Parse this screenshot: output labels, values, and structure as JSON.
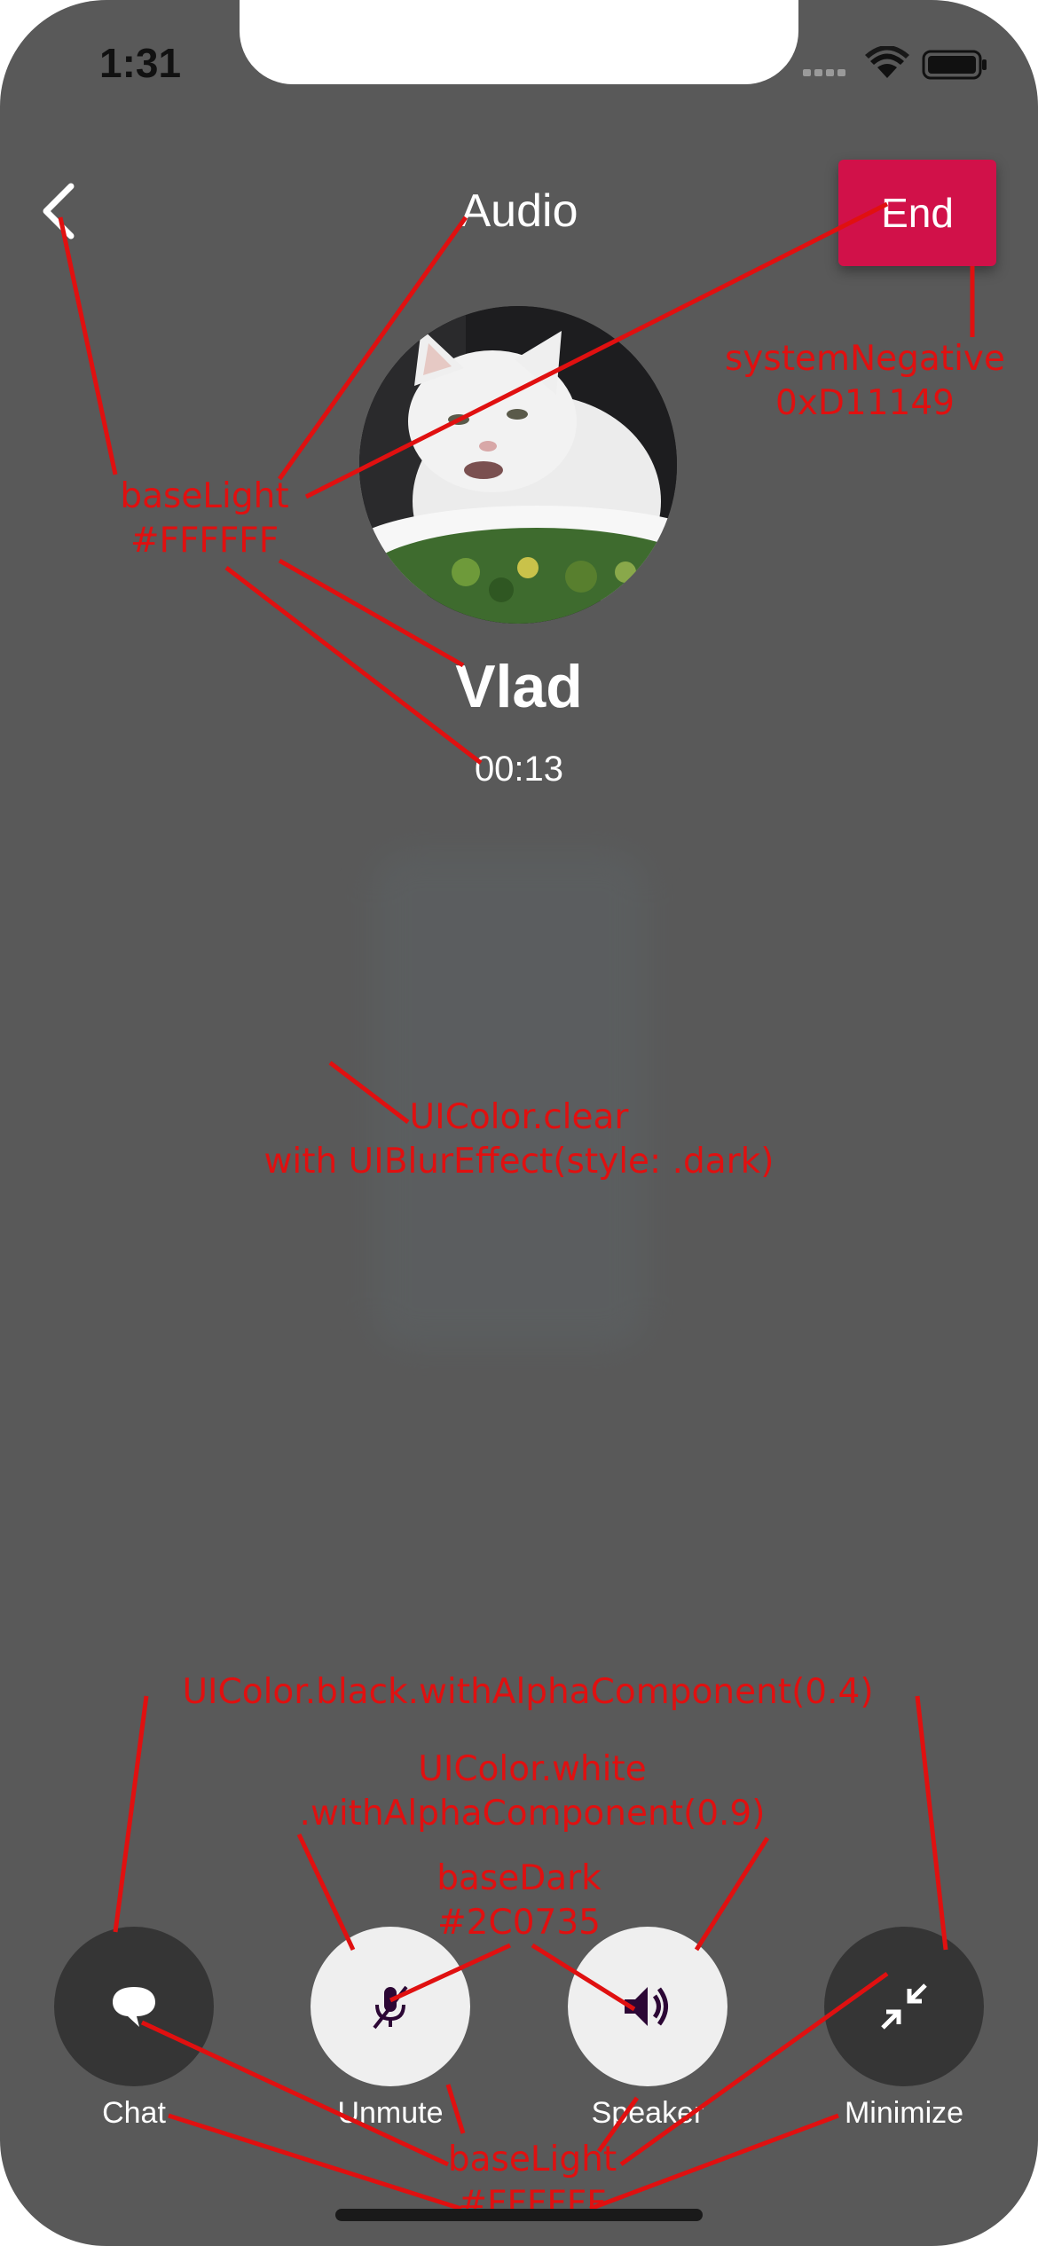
{
  "status_bar": {
    "time": "1:31"
  },
  "nav": {
    "title": "Audio",
    "end_label": "End"
  },
  "caller": {
    "name": "Vlad",
    "timer": "00:13"
  },
  "controls": [
    {
      "id": "chat",
      "label": "Chat",
      "icon": "chat-bubble-icon"
    },
    {
      "id": "unmute",
      "label": "Unmute",
      "icon": "mic-off-icon"
    },
    {
      "id": "speaker",
      "label": "Speaker",
      "icon": "speaker-icon"
    },
    {
      "id": "minimize",
      "label": "Minimize",
      "icon": "minimize-arrows-icon"
    }
  ],
  "annotations": {
    "base_light_top": {
      "line1": "baseLight",
      "line2": "#FFFFFF"
    },
    "system_negative": {
      "line1": "systemNegative",
      "line2": "0xD11149"
    },
    "blur": {
      "line1": "UIColor.clear",
      "line2": "with UIBlurEffect(style: .dark)"
    },
    "black_alpha": "UIColor.black.withAlphaComponent(0.4)",
    "white_alpha": {
      "line1": "UIColor.white",
      "line2": ".withAlphaComponent(0.9)"
    },
    "base_dark": {
      "line1": "baseDark",
      "line2": "#2C0735"
    },
    "base_light_bottom": {
      "line1": "baseLight",
      "line2": "#FFFFFF"
    }
  },
  "colors": {
    "background": "#595959",
    "system_negative": "#D11149",
    "base_light": "#FFFFFF",
    "base_dark": "#2C0735",
    "annotation": "#E01010"
  }
}
